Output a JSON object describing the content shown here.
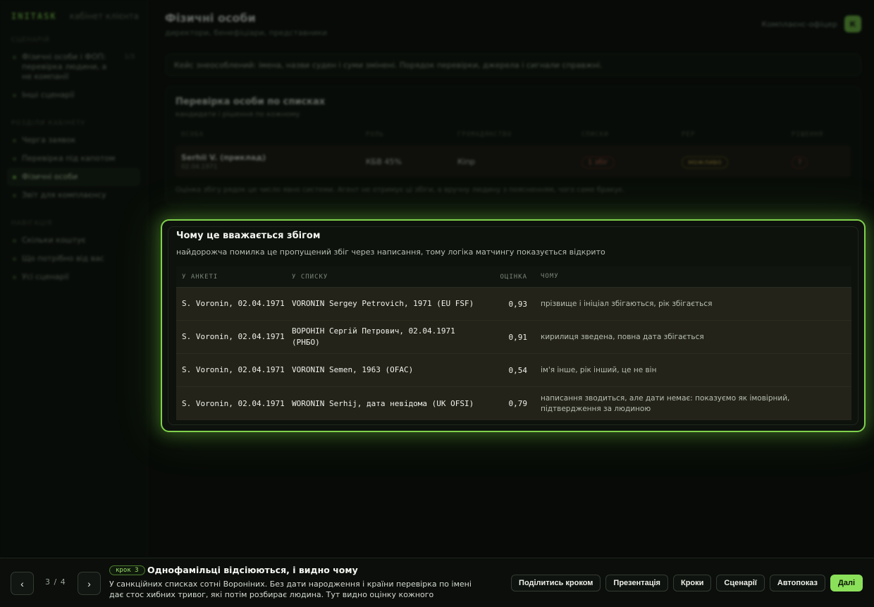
{
  "app": {
    "brand": "INITASK",
    "brand_sub": "кабінет клієнта",
    "sidebar": {
      "sections": [
        {
          "label": "Сценарій",
          "items": [
            {
              "label": "Фізичні особи і ФОП: перевірка людини, а не компанії",
              "badge": "1/3"
            },
            {
              "label": "Інші сценарії",
              "badge": ""
            }
          ]
        },
        {
          "label": "Розділи кабінету",
          "items": [
            {
              "label": "Черга заявок",
              "badge": ""
            },
            {
              "label": "Перевірка під капотом",
              "badge": ""
            },
            {
              "label": "Фізичні особи",
              "badge": "",
              "active": true
            },
            {
              "label": "Звіт для комплаєнсу",
              "badge": ""
            }
          ]
        },
        {
          "label": "Навігація",
          "items": [
            {
              "label": "Скільки коштує",
              "badge": ""
            },
            {
              "label": "Що потрібно від вас",
              "badge": ""
            },
            {
              "label": "Усі сценарії",
              "badge": ""
            }
          ]
        }
      ]
    },
    "header": {
      "title": "Фізичні особи",
      "subtitle": "директори, бенефіціари, представники",
      "user_label": "Комплаєнс-офіцер",
      "avatar_letter": "К"
    },
    "case_banner": "Кейс знеособлений: імена, назви суден і суми змінені. Порядок перевірки, джерела і сигнали справжні.",
    "bg_card": {
      "title": "Перевірка особи по списках",
      "subtitle": "кандидати і рішення по кожному",
      "headers": [
        "Особа",
        "Роль",
        "Громадянство",
        "Списки",
        "PEP",
        "Рішення"
      ],
      "row": {
        "name": "Serhii V. (приклад)",
        "date": "02.04.1971",
        "role": "КБВ 45%",
        "citizenship": "Кіпр",
        "lists": "1 збіг",
        "pep": "можливо",
        "decision": "?"
      },
      "footnote": "Оцінка збігу рядок це число явно системи. Агент не отримує ці збіги, а вручну людину з поясненням, чого саме бракує."
    }
  },
  "focus": {
    "title": "Чому це вважається збігом",
    "subtitle": "найдорожча помилка це пропущений збіг через написання, тому логіка матчингу показується відкрито",
    "headers": {
      "anketa": "У анкеті",
      "list": "У списку",
      "score": "Оцінка",
      "why": "Чому"
    },
    "rows": [
      {
        "anketa": "S. Voronin, 02.04.1971",
        "list": "VORONIN Sergey Petrovich, 1971 (EU FSF)",
        "score": "0,93",
        "why": "прізвище і ініціал збігаються, рік збігається"
      },
      {
        "anketa": "S. Voronin, 02.04.1971",
        "list": "ВОРОНІН Сергій Петрович, 02.04.1971 (РНБО)",
        "score": "0,91",
        "why": "кирилиця зведена, повна дата збігається"
      },
      {
        "anketa": "S. Voronin, 02.04.1971",
        "list": "VORONIN Semen, 1963 (OFAC)",
        "score": "0,54",
        "why": "ім'я інше, рік інший, це не він"
      },
      {
        "anketa": "S. Voronin, 02.04.1971",
        "list": "WORONIN Serhij, дата невідома (UK OFSI)",
        "score": "0,79",
        "why": "написання зводиться, але дати немає: показуємо як імовірний, підтвердження за людиною"
      }
    ]
  },
  "tour": {
    "prev_icon": "‹",
    "next_icon": "›",
    "counter": "3 / 4",
    "step_tag": "крок 3",
    "step_title": "Однофамільці відсіюються, і видно чому",
    "step_desc": "У санкційних списках сотні Воронiних. Без дати народження і країни перевірка по імені дає стос хибних тривог, які потім розбирає людина. Тут видно оцінку кожного кандидат...",
    "actions": {
      "share": "Поділитись кроком",
      "presentation": "Презентація",
      "steps": "Кроки",
      "scenarios": "Сценарії",
      "autoplay": "Автопоказ",
      "next": "Далі"
    }
  }
}
